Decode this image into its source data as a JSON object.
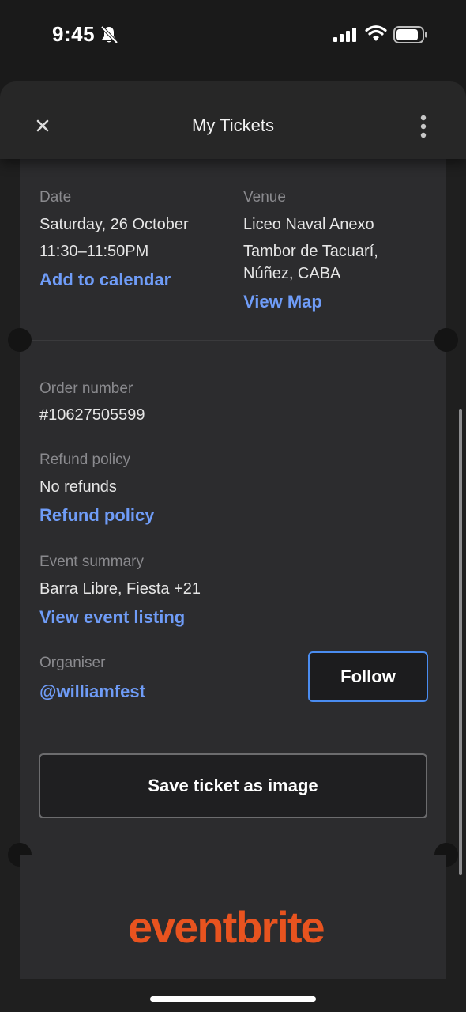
{
  "status_bar": {
    "time": "9:45"
  },
  "header": {
    "title": "My Tickets",
    "close_icon": "close-icon",
    "more_icon": "more-vertical-icon"
  },
  "event": {
    "date_label": "Date",
    "date_value": "Saturday, 26 October",
    "time_value": "11:30–11:50PM",
    "add_to_calendar": "Add to calendar",
    "venue_label": "Venue",
    "venue_name": "Liceo Naval Anexo",
    "venue_address": "Tambor de Tacuarí, Núñez, CABA",
    "view_map": "View Map"
  },
  "order": {
    "order_label": "Order number",
    "order_value": "#10627505599",
    "refund_label": "Refund policy",
    "refund_value": "No refunds",
    "refund_link": "Refund policy",
    "summary_label": "Event summary",
    "summary_value": "Barra Libre, Fiesta +21",
    "view_listing": "View event listing",
    "organiser_label": "Organiser",
    "organiser_handle": "@williamfest",
    "follow_label": "Follow",
    "save_label": "Save ticket as image"
  },
  "brand": {
    "logo_text": "eventbrite",
    "logo_color": "#e8531f"
  },
  "colors": {
    "accent_link": "#6f9cf7",
    "follow_border": "#4a8cf0"
  }
}
